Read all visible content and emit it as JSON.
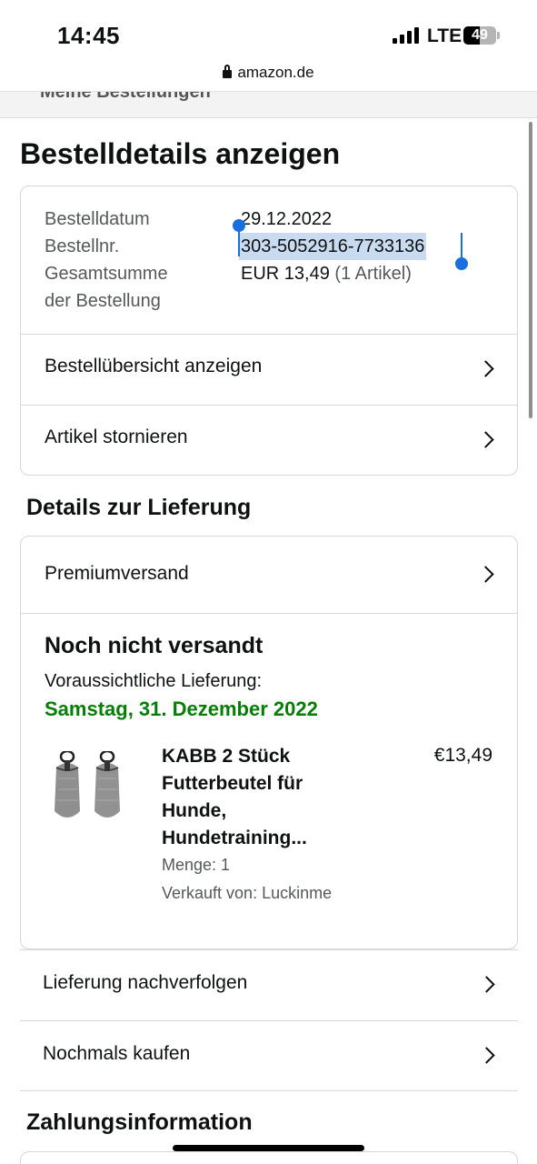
{
  "status_bar": {
    "time": "14:45",
    "network": "LTE",
    "battery": "49",
    "battery_level": 0.49
  },
  "browser": {
    "url": "amazon.de"
  },
  "previous_section": {
    "title": "Meine Bestellungen"
  },
  "page": {
    "title": "Bestelldetails anzeigen"
  },
  "order_summary": {
    "date_label": "Bestelldatum",
    "date_value": "29.12.2022",
    "number_label": "Bestellnr.",
    "number_value": "303-5052916-7733136",
    "total_label_line1": "Gesamtsumme",
    "total_label_line2": "der Bestellung",
    "total_value": "EUR 13,49",
    "total_items": "(1 Artikel)",
    "links": [
      {
        "label": "Bestellübersicht anzeigen"
      },
      {
        "label": "Artikel stornieren"
      }
    ]
  },
  "delivery": {
    "section_title": "Details zur Lieferung",
    "shipping_method": "Premiumversand",
    "status": "Noch nicht versandt",
    "expected_label": "Voraussichtliche Lieferung:",
    "expected_date": "Samstag, 31. Dezember 2022",
    "item": {
      "title_lines": [
        "KABB 2 Stück",
        "Futterbeutel für",
        "Hunde,",
        "Hundetraining..."
      ],
      "price": "€13,49",
      "quantity": "Menge: 1",
      "seller": "Verkauft von: Luckinme",
      "image_icon": "dog-treat-pouch-image"
    },
    "actions": [
      {
        "label": "Lieferung nachverfolgen"
      },
      {
        "label": "Nochmals kaufen"
      }
    ]
  },
  "payment": {
    "section_title": "Zahlungsinformation"
  },
  "colors": {
    "delivery_green": "#067d06",
    "selection": "#c9dbf1",
    "selection_handle": "#1a6fde",
    "border": "#d5d9d9"
  }
}
